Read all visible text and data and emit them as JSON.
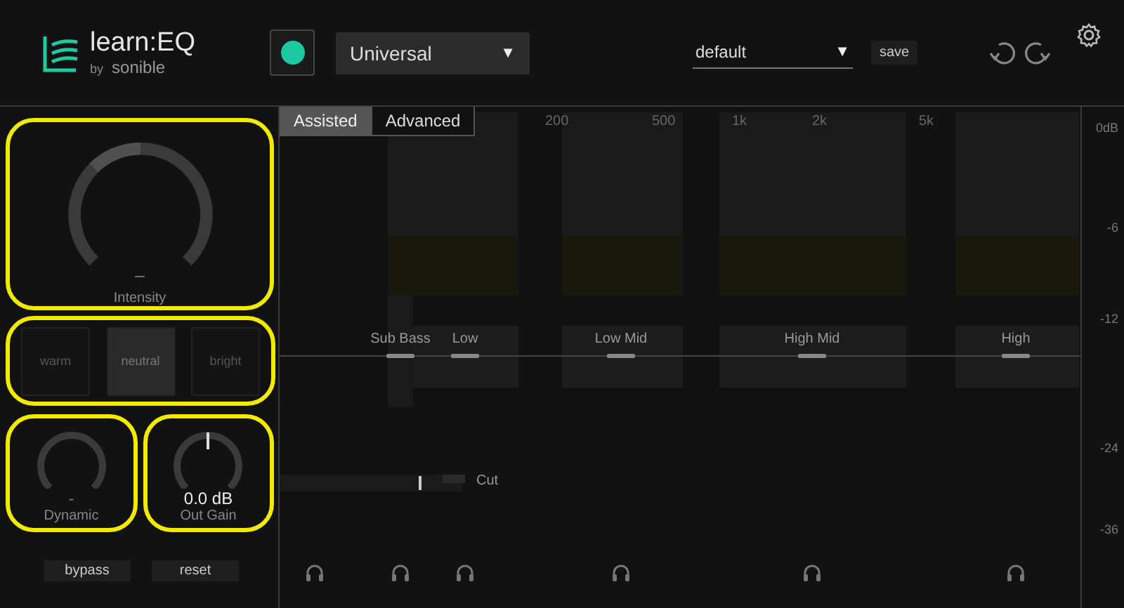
{
  "header": {
    "logo": {
      "name": "learn:EQ",
      "by": "by",
      "brand": "sonible"
    },
    "power": {
      "on": true
    },
    "profile": {
      "value": "Universal",
      "caret": "▼"
    },
    "preset": {
      "value": "default",
      "caret": "▼"
    },
    "save": "save"
  },
  "left_panel": {
    "intensity": {
      "value": "–",
      "label": "Intensity"
    },
    "styles": [
      {
        "label": "warm",
        "selected": false
      },
      {
        "label": "neutral",
        "selected": true
      },
      {
        "label": "bright",
        "selected": false
      }
    ],
    "dynamic": {
      "value": "-",
      "label": "Dynamic"
    },
    "out_gain": {
      "value": "0.0 dB",
      "label": "Out Gain"
    },
    "buttons": [
      "bypass",
      "reset"
    ]
  },
  "tabs": [
    {
      "label": "Assisted",
      "selected": true
    },
    {
      "label": "Advanced",
      "selected": false
    }
  ],
  "freq_labels": [
    "200",
    "500",
    "1k",
    "2k",
    "5k"
  ],
  "db_labels": [
    "0dB",
    "-6",
    "-12",
    "-24",
    "-36"
  ],
  "cut": {
    "label": "Cut",
    "level": 0.77
  },
  "bands": [
    {
      "name": "Sub Bass"
    },
    {
      "name": "Low"
    },
    {
      "name": "Low Mid"
    },
    {
      "name": "High Mid"
    },
    {
      "name": "High"
    }
  ]
}
